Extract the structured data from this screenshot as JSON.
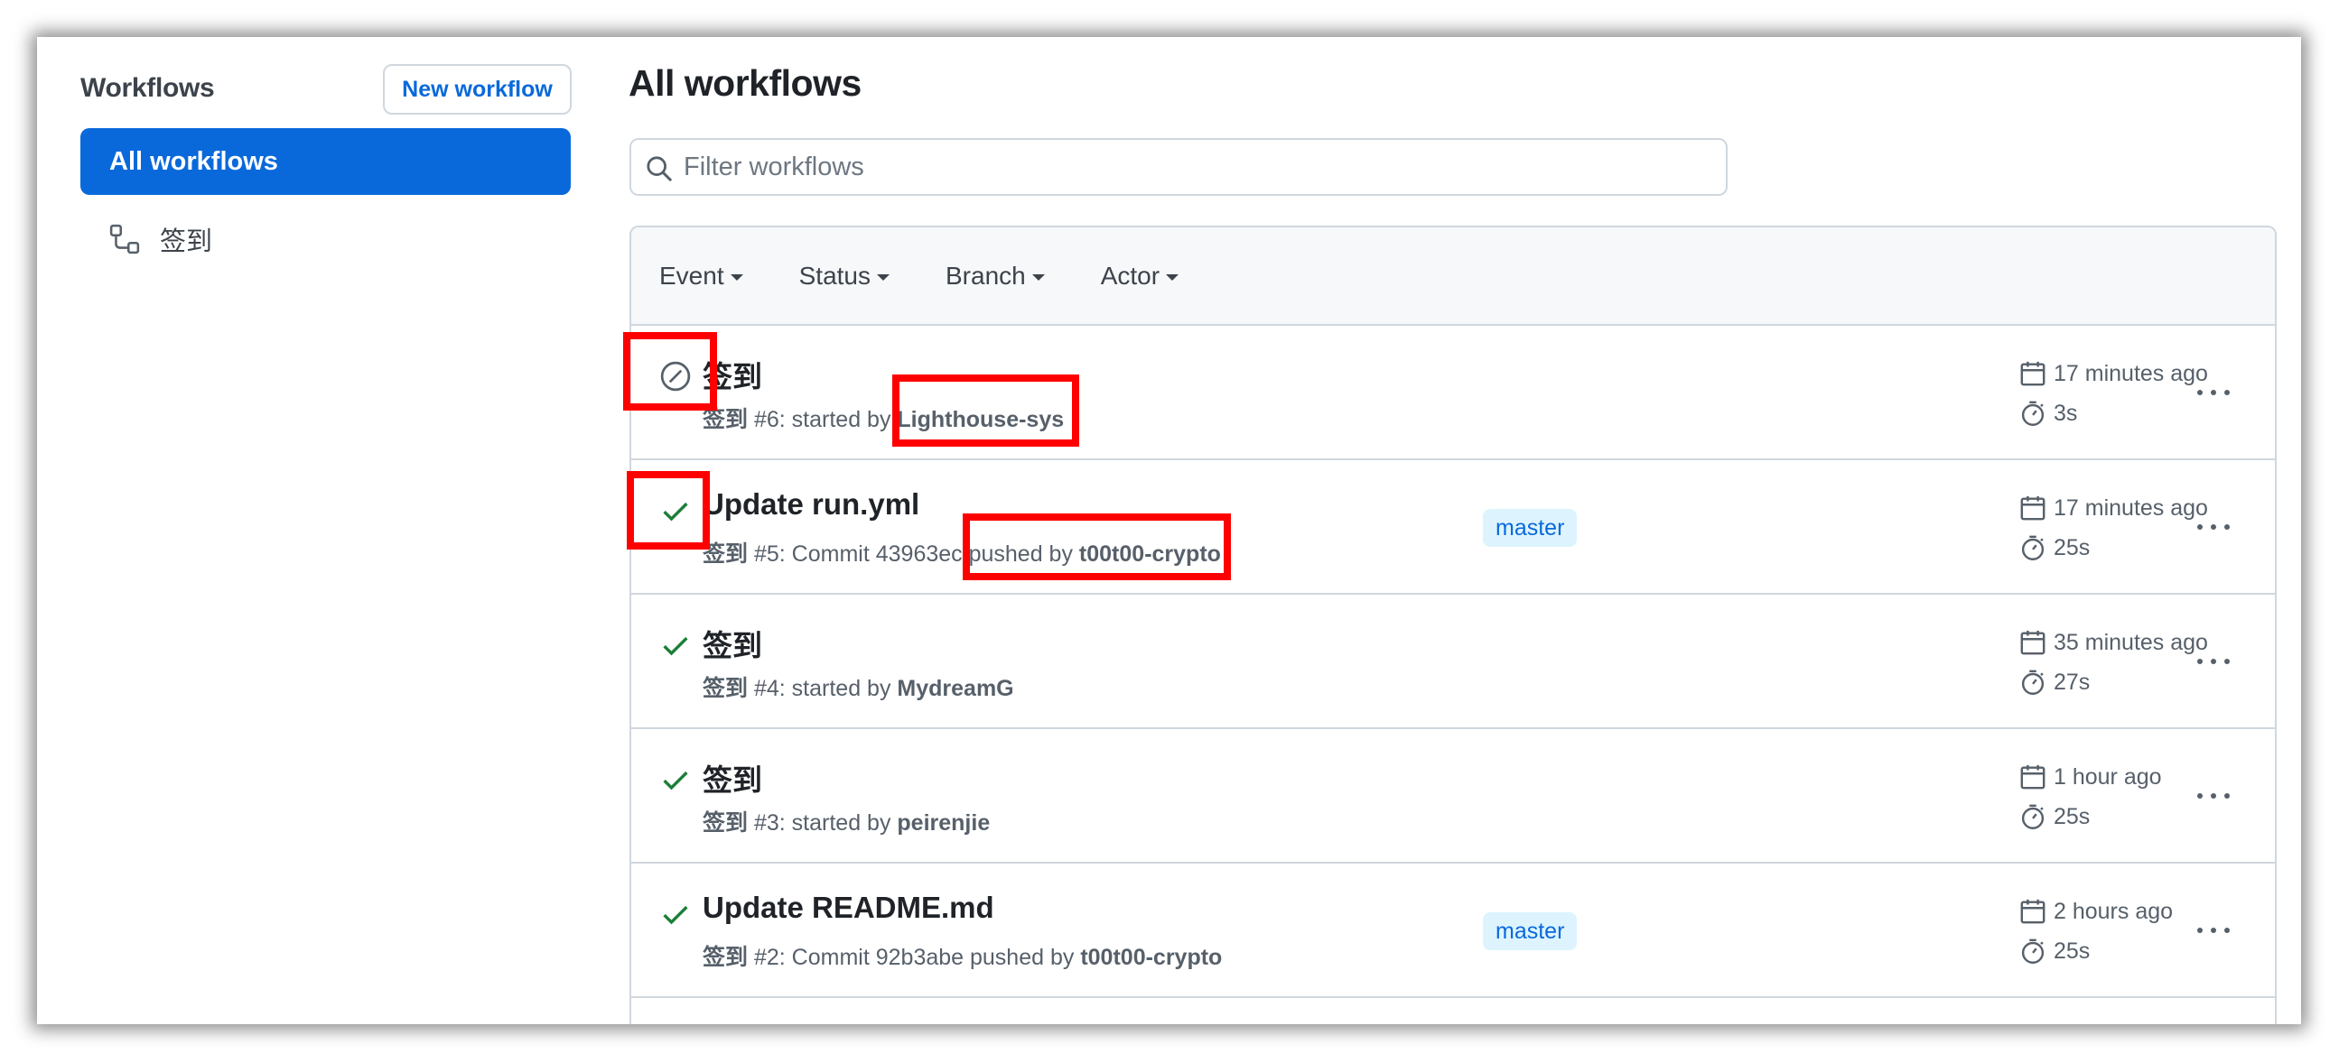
{
  "sidebar": {
    "title": "Workflows",
    "new_workflow_label": "New workflow",
    "items": [
      {
        "label": "All workflows",
        "active": true
      },
      {
        "label": "签到",
        "icon": "workflow-icon"
      }
    ]
  },
  "main": {
    "title": "All workflows",
    "filter_placeholder": "Filter workflows",
    "filters": [
      "Event",
      "Status",
      "Branch",
      "Actor"
    ],
    "runs": [
      {
        "status": "skipped",
        "title": "签到",
        "workflow": "签到",
        "number": "#6",
        "detail": ": started by ",
        "actor": "Lighthouse-sys",
        "branch": "",
        "time": "17 minutes ago",
        "duration": "3s"
      },
      {
        "status": "success",
        "title": "Update run.yml",
        "workflow": "签到",
        "number": "#5",
        "detail": ": Commit 43963ec pushed by ",
        "actor": "t00t00-crypto",
        "branch": "master",
        "time": "17 minutes ago",
        "duration": "25s"
      },
      {
        "status": "success",
        "title": "签到",
        "workflow": "签到",
        "number": "#4",
        "detail": ": started by ",
        "actor": "MydreamG",
        "branch": "",
        "time": "35 minutes ago",
        "duration": "27s"
      },
      {
        "status": "success",
        "title": "签到",
        "workflow": "签到",
        "number": "#3",
        "detail": ": started by ",
        "actor": "peirenjie",
        "branch": "",
        "time": "1 hour ago",
        "duration": "25s"
      },
      {
        "status": "success",
        "title": "Update README.md",
        "workflow": "签到",
        "number": "#2",
        "detail": ": Commit 92b3abe pushed by ",
        "actor": "t00t00-crypto",
        "branch": "master",
        "time": "2 hours ago",
        "duration": "25s"
      }
    ]
  },
  "colors": {
    "accent": "#0969da",
    "success": "#1a7f37",
    "muted": "#57606a",
    "annotation": "#ff0000"
  }
}
